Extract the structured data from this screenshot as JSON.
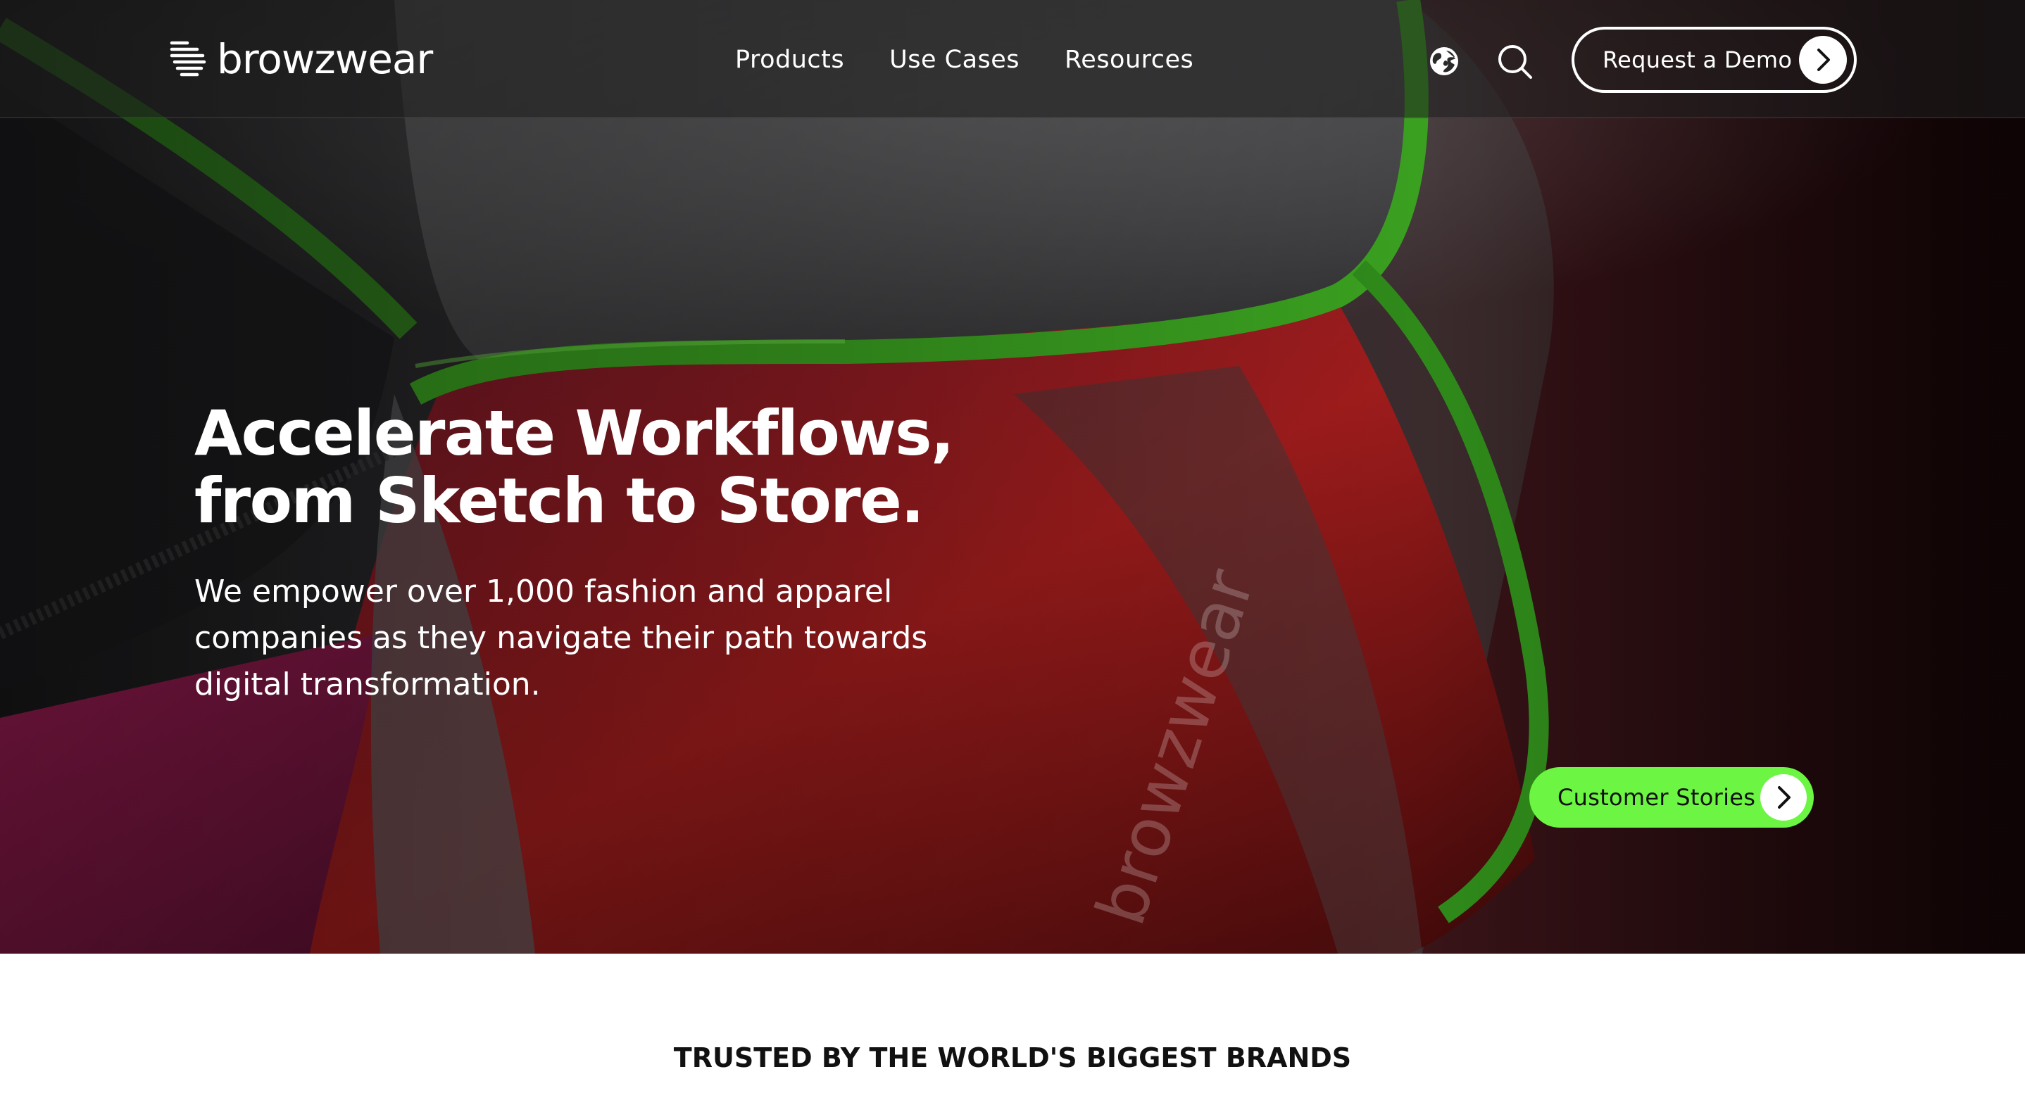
{
  "header": {
    "logo_text": "browzwear",
    "nav": {
      "products": "Products",
      "use_cases": "Use Cases",
      "resources": "Resources"
    },
    "demo_button_label": "Request a Demo"
  },
  "hero": {
    "title_line1": "Accelerate Workflows,",
    "title_line2": "from Sketch to Store.",
    "subtitle": "We empower over 1,000 fashion and apparel companies as they navigate their path towards digital transformation.",
    "fabric_print": "browzwear",
    "cta_label": "Customer Stories"
  },
  "trusted": {
    "heading": "TRUSTED BY THE WORLD'S BIGGEST BRANDS"
  },
  "icons": {
    "language": "globe-icon",
    "search": "search-icon",
    "arrow": "chevron-right-icon"
  },
  "colors": {
    "accent_green": "#6cf542",
    "hero_pink": "#c8246a",
    "hero_red": "#8a1416",
    "text_white": "#ffffff",
    "text_dark": "#111111"
  }
}
